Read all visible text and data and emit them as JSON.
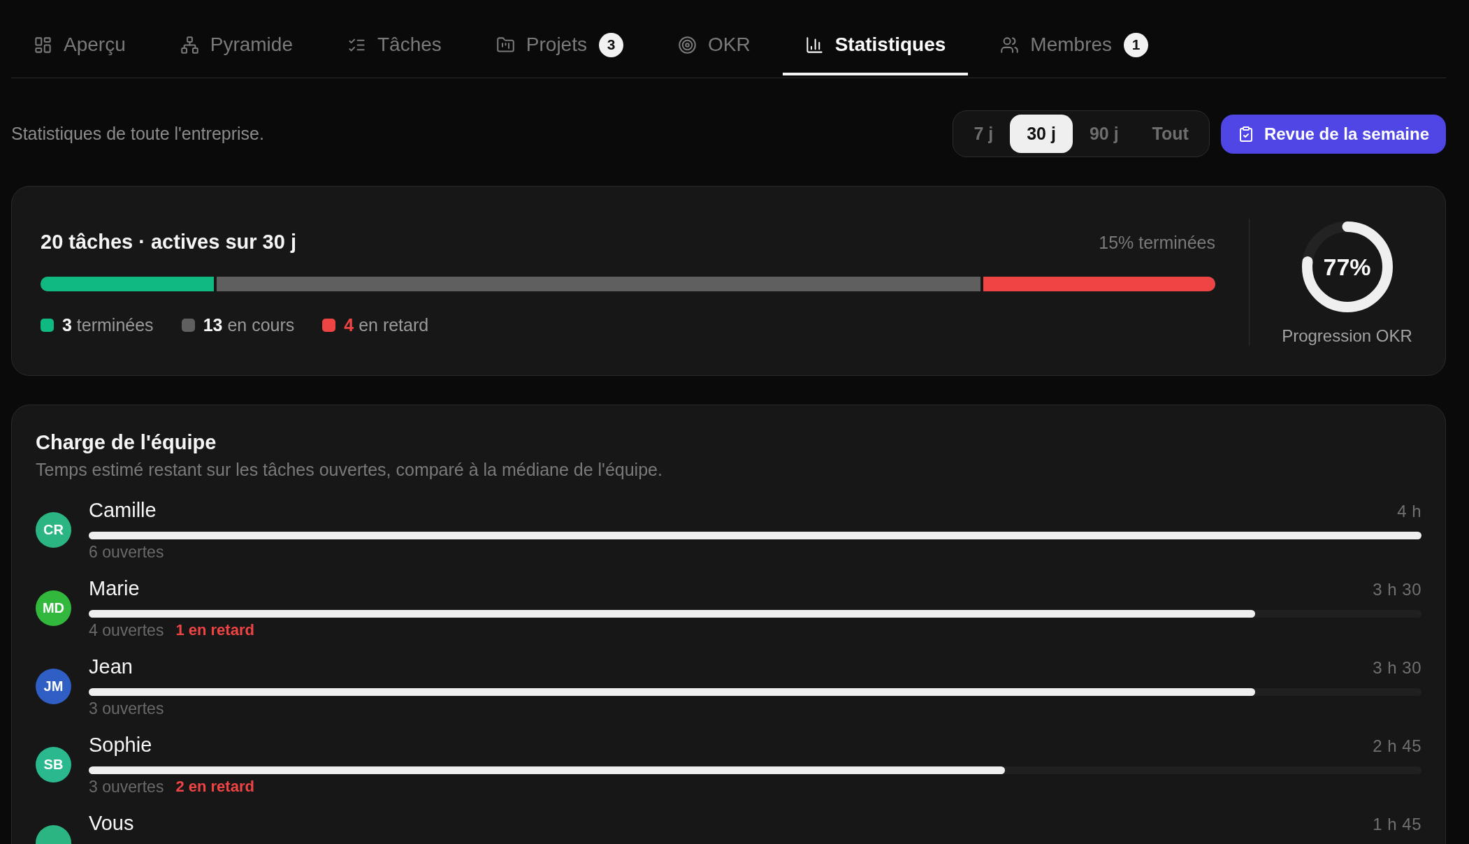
{
  "tabs": [
    {
      "label": "Aperçu",
      "selected": false
    },
    {
      "label": "Pyramide",
      "selected": false
    },
    {
      "label": "Tâches",
      "selected": false
    },
    {
      "label": "Projets",
      "badge": "3",
      "selected": false
    },
    {
      "label": "OKR",
      "selected": false
    },
    {
      "label": "Statistiques",
      "selected": true
    },
    {
      "label": "Membres",
      "badge": "1",
      "selected": false
    }
  ],
  "scope_text": "Statistiques de toute l'entreprise.",
  "ranges": [
    {
      "label": "7 j",
      "selected": false
    },
    {
      "label": "30 j",
      "selected": true
    },
    {
      "label": "90 j",
      "selected": false
    },
    {
      "label": "Tout",
      "selected": false
    }
  ],
  "review_button": {
    "label": "Revue de la semaine"
  },
  "summary": {
    "title": "20 tâches · actives sur 30 j",
    "done_share": "15% terminées",
    "breakdown": [
      {
        "kind": "done",
        "count": "3",
        "label": "terminées",
        "color": "#10b981",
        "level": 0.15
      },
      {
        "kind": "in_progress",
        "count": "13",
        "label": "en cours",
        "color": "#5f5f5f"
      },
      {
        "kind": "late",
        "count": "4",
        "label": "en retard",
        "color": "#ef4444",
        "level": 0.2
      }
    ],
    "okr": {
      "value": "77%",
      "label": "Progression OKR",
      "level": 0.77
    }
  },
  "workload": {
    "title": "Charge de l'équipe",
    "subtitle": "Temps estimé restant sur les tâches ouvertes, comparé à la médiane de l'équipe.",
    "members": [
      {
        "initials": "CR",
        "name": "Camille",
        "color": "#2bb582",
        "hours": "4 h",
        "level": 1,
        "open": "6 ouvertes"
      },
      {
        "initials": "MD",
        "name": "Marie",
        "color": "#33b83e",
        "hours": "3 h 30",
        "level": 0.875,
        "open": "4 ouvertes",
        "late": "1 en retard"
      },
      {
        "initials": "JM",
        "name": "Jean",
        "color": "#2f5ec4",
        "hours": "3 h 30",
        "level": 0.875,
        "open": "3 ouvertes"
      },
      {
        "initials": "SB",
        "name": "Sophie",
        "color": "#2ab88e",
        "hours": "2 h 45",
        "level": 0.6875,
        "open": "3 ouvertes",
        "late": "2 en retard"
      },
      {
        "name": "Vous",
        "color": "#2bb582",
        "hours": "1 h 45"
      }
    ]
  }
}
